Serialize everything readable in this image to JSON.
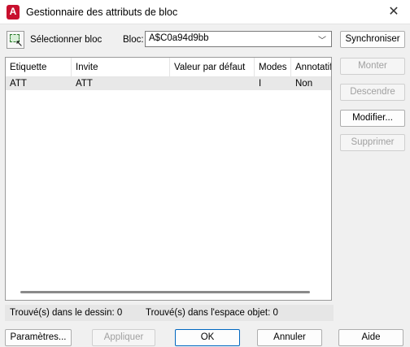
{
  "window": {
    "title": "Gestionnaire des attributs de bloc",
    "close_glyph": "✕"
  },
  "toolbar": {
    "select_block_label": "Sélectionner bloc",
    "block_label": "Bloc:",
    "block_value": "A$C0a94d9bb",
    "sync_label": "Synchroniser"
  },
  "table": {
    "columns": [
      "Etiquette",
      "Invite",
      "Valeur par défaut",
      "Modes",
      "Annotatif"
    ],
    "rows": [
      {
        "tag": "ATT",
        "prompt": "ATT",
        "default": "",
        "modes": "I",
        "annotative": "Non"
      }
    ]
  },
  "side_buttons": {
    "up": "Monter",
    "down": "Descendre",
    "edit": "Modifier...",
    "delete": "Supprimer"
  },
  "status": {
    "found_drawing": "Trouvé(s) dans le dessin: 0",
    "found_space": "Trouvé(s) dans l'espace objet: 0"
  },
  "footer": {
    "settings": "Paramètres...",
    "apply": "Appliquer",
    "ok": "OK",
    "cancel": "Annuler",
    "help": "Aide"
  }
}
